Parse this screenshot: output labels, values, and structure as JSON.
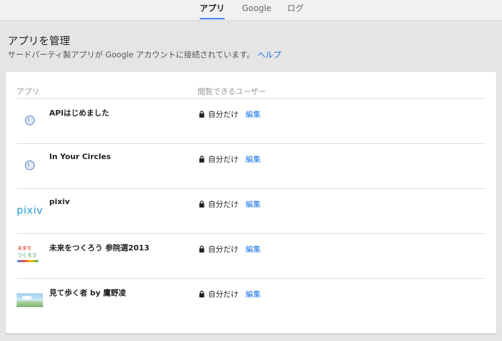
{
  "tabs": [
    {
      "label": "アプリ",
      "active": true
    },
    {
      "label": "Google",
      "active": false
    },
    {
      "label": "ログ",
      "active": false
    }
  ],
  "header": {
    "title": "アプリを管理",
    "subtitle": "サードパーティ製アプリが Google アカウントに接続されています。",
    "help_link": "ヘルプ"
  },
  "table": {
    "col_app": "アプリ",
    "col_viewers": "閲覧できるユーザー",
    "rows": [
      {
        "name": "APIはじめました",
        "icon": "globe-icon",
        "access": "自分だけ",
        "edit": "編集"
      },
      {
        "name": "In Your Circles",
        "icon": "globe-icon",
        "access": "自分だけ",
        "edit": "編集"
      },
      {
        "name": "pixiv",
        "icon": "pixiv-logo",
        "icon_text": "pixiv",
        "access": "自分だけ",
        "edit": "編集"
      },
      {
        "name": "未来をつくろう 参院選2013",
        "icon": "mirai-logo",
        "icon_text_1": "未来を",
        "icon_text_2": "つくろう",
        "access": "自分だけ",
        "edit": "編集"
      },
      {
        "name": "見て歩く者 by 鷹野凌",
        "icon": "landscape-thumbnail",
        "access": "自分だけ",
        "edit": "編集"
      }
    ]
  },
  "colors": {
    "accent": "#4285f4",
    "link": "#1a73e8",
    "pixiv": "#2a9bd8"
  }
}
